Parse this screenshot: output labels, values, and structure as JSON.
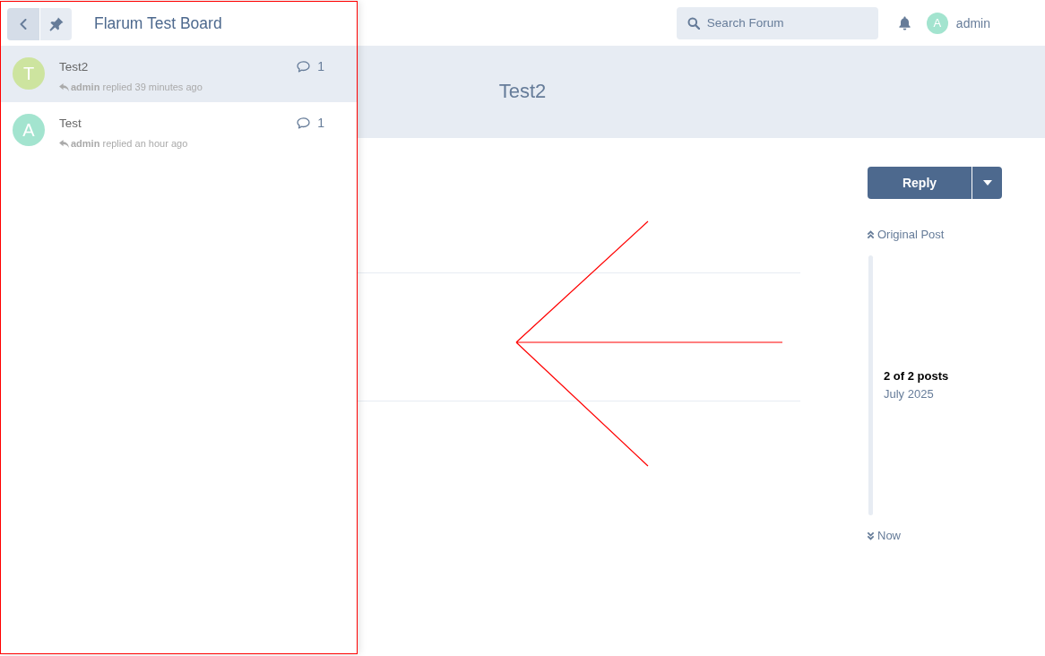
{
  "drawer": {
    "highlighted": true,
    "buttons": [
      {
        "kind": "back"
      },
      {
        "kind": "pin"
      }
    ],
    "title": "Flarum Test Board",
    "discussions": [
      {
        "avatar_letter": "T",
        "color": "#cde49f",
        "title": "Test2",
        "meta": "**admin** replied 39 minutes ago",
        "replies": "1",
        "selected": true
      },
      {
        "avatar_letter": "A",
        "color": "#a3e4cf",
        "title": "Test",
        "meta": "**admin** replied an hour ago",
        "replies": "1",
        "selected": false
      }
    ]
  },
  "header": {
    "search": {
      "placeholder": "Search Forum"
    },
    "user": {
      "avatar_letter": "A",
      "color": "#a3e4cf",
      "name": "admin"
    }
  },
  "hero": {
    "title": "Test2"
  },
  "discussion_sidebar": {
    "reply_button": "Reply",
    "scrubber": {
      "top_link": "Original Post",
      "position": "2 of 2 posts",
      "date": "July 2025",
      "bottom_link": "Now"
    }
  },
  "annotations": [
    {
      "kind": "arrow"
    }
  ]
}
